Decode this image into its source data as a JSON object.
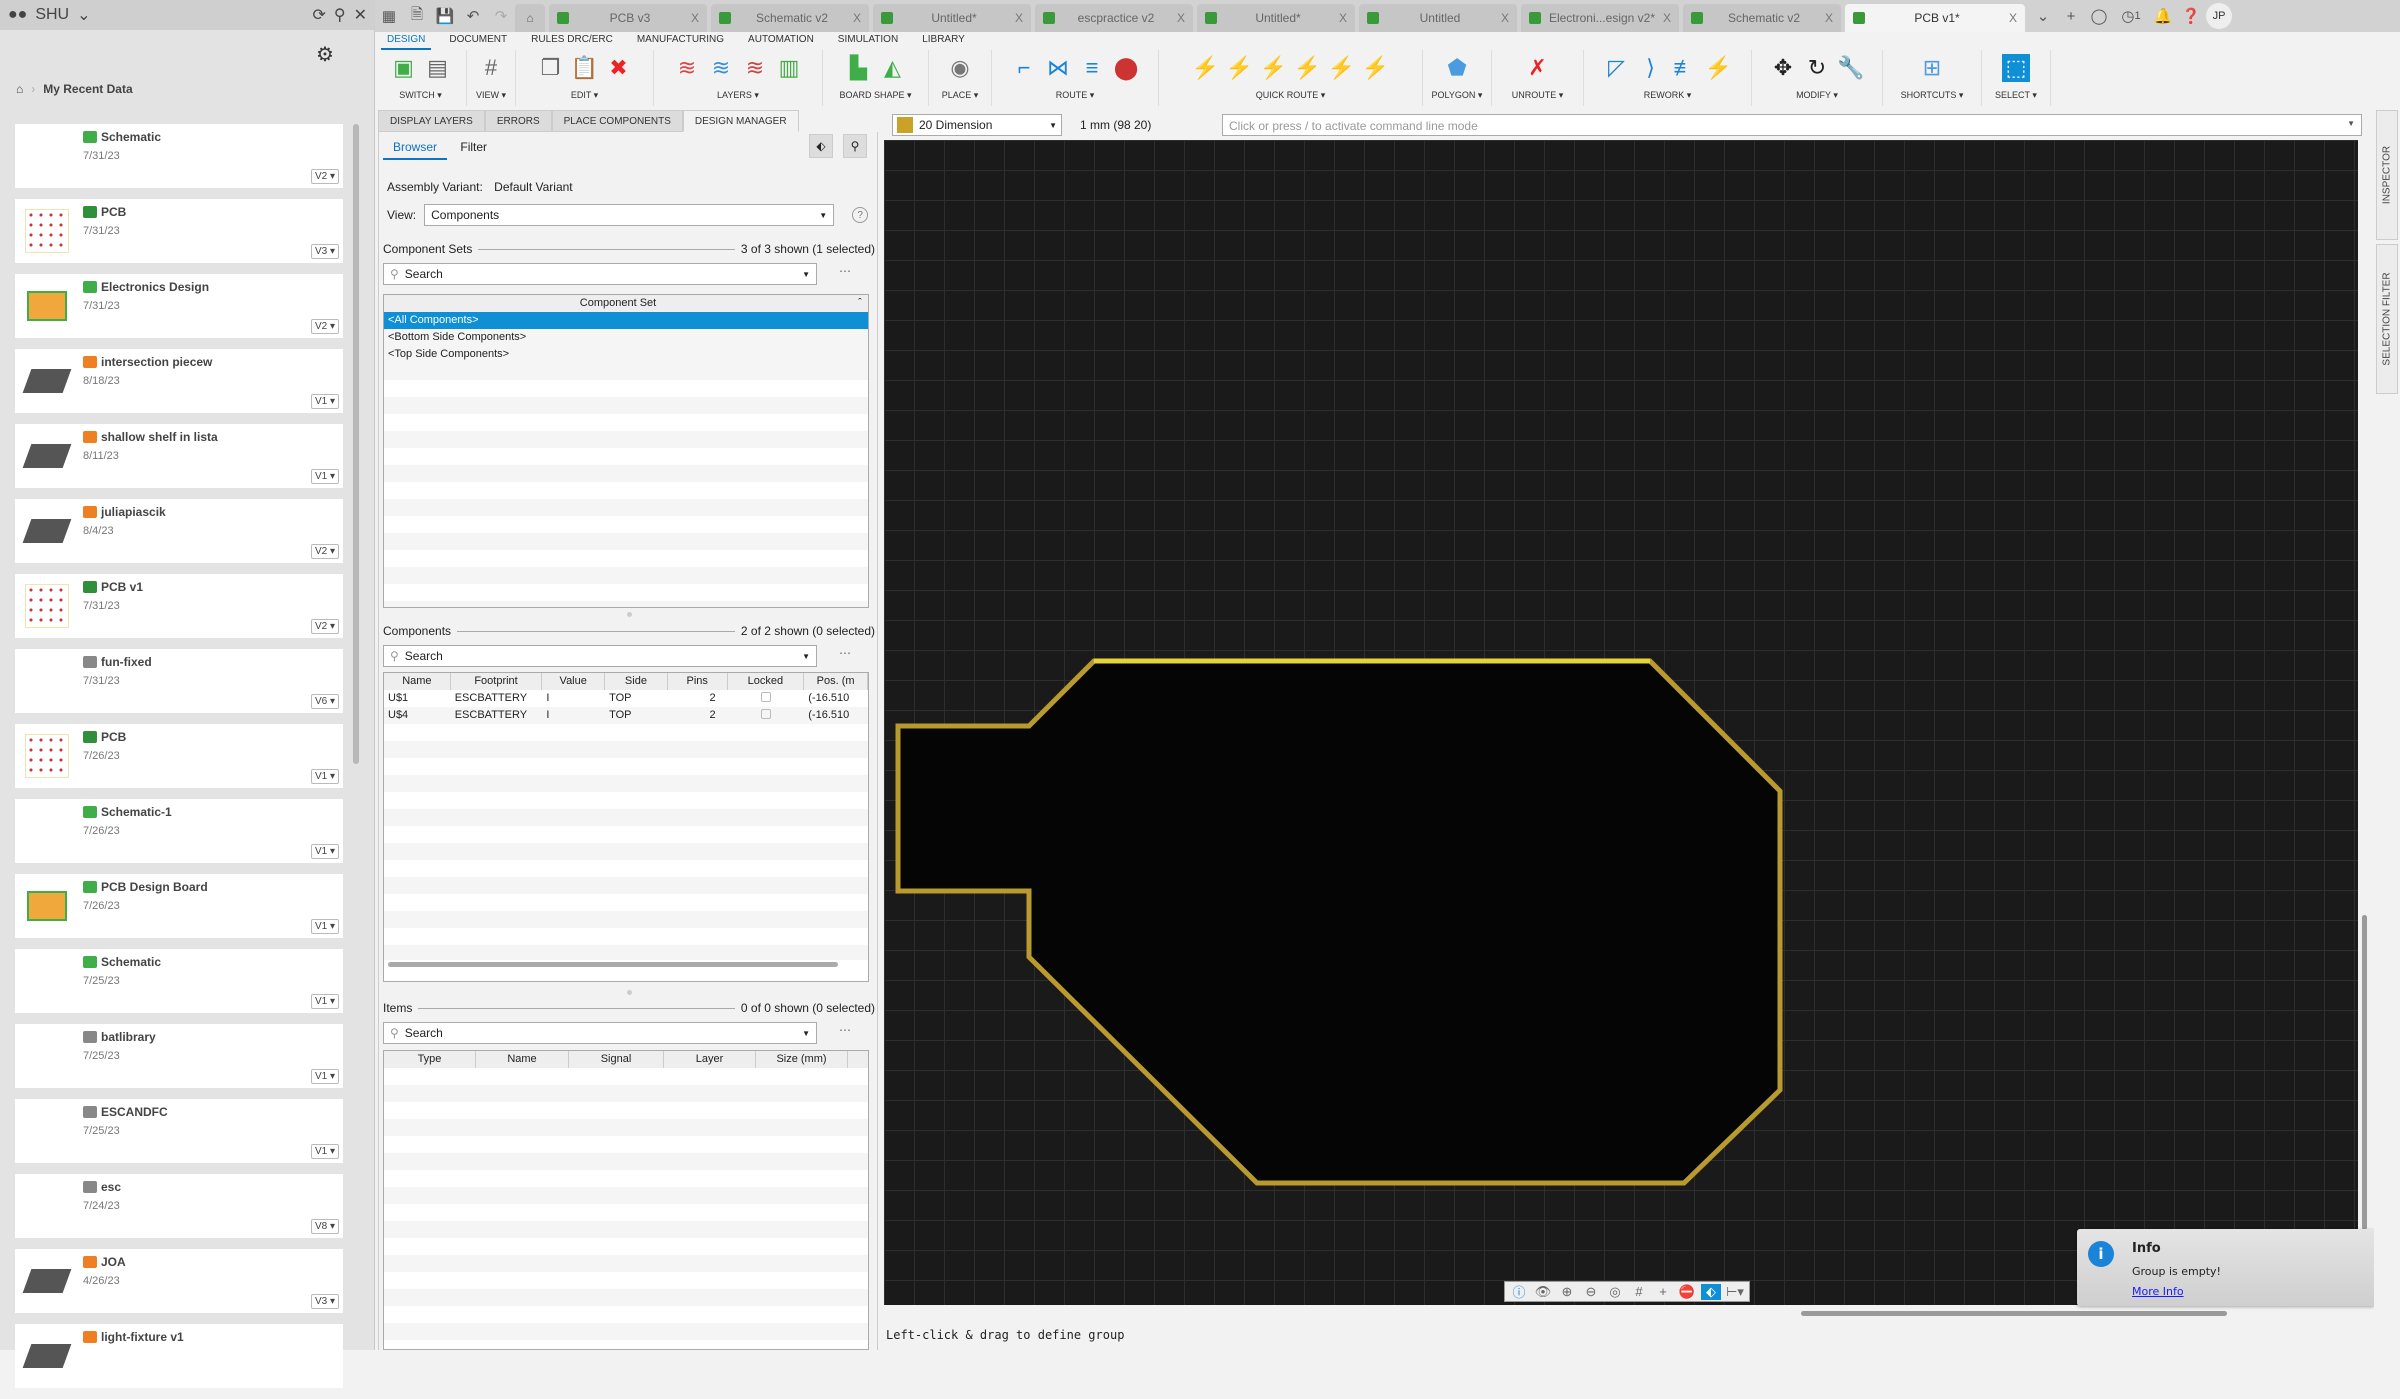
{
  "left_panel": {
    "team": "SHU",
    "breadcrumb": "My Recent Data",
    "files": [
      {
        "name": "Schematic",
        "date": "7/31/23",
        "version": "V2",
        "type": "schematic"
      },
      {
        "name": "PCB",
        "date": "7/31/23",
        "version": "V3",
        "type": "pcb"
      },
      {
        "name": "Electronics Design",
        "date": "7/31/23",
        "version": "V2",
        "type": "electronics"
      },
      {
        "name": "intersection piecew",
        "date": "8/18/23",
        "version": "V1",
        "type": "3d"
      },
      {
        "name": "shallow shelf in lista",
        "date": "8/11/23",
        "version": "V1",
        "type": "3d"
      },
      {
        "name": "juliapiascik",
        "date": "8/4/23",
        "version": "V2",
        "type": "3d"
      },
      {
        "name": "PCB v1",
        "date": "7/31/23",
        "version": "V2",
        "type": "pcb"
      },
      {
        "name": "fun-fixed",
        "date": "7/31/23",
        "version": "V6",
        "type": "library"
      },
      {
        "name": "PCB",
        "date": "7/26/23",
        "version": "V1",
        "type": "pcb"
      },
      {
        "name": "Schematic-1",
        "date": "7/26/23",
        "version": "V1",
        "type": "schematic"
      },
      {
        "name": "PCB Design Board",
        "date": "7/26/23",
        "version": "V1",
        "type": "electronics"
      },
      {
        "name": "Schematic",
        "date": "7/25/23",
        "version": "V1",
        "type": "schematic"
      },
      {
        "name": "batlibrary",
        "date": "7/25/23",
        "version": "V1",
        "type": "library"
      },
      {
        "name": "ESCANDFC",
        "date": "7/25/23",
        "version": "V1",
        "type": "library"
      },
      {
        "name": "esc",
        "date": "7/24/23",
        "version": "V8",
        "type": "library"
      },
      {
        "name": "JOA",
        "date": "4/26/23",
        "version": "V3",
        "type": "3d"
      },
      {
        "name": "light-fixture v1",
        "date": "",
        "version": "",
        "type": "3d"
      }
    ]
  },
  "doc_tabs": [
    {
      "label": "PCB v3",
      "active": false
    },
    {
      "label": "Schematic v2",
      "active": false
    },
    {
      "label": "Untitled*",
      "active": false
    },
    {
      "label": "escpractice v2",
      "active": false
    },
    {
      "label": "Untitled*",
      "active": false
    },
    {
      "label": "Untitled",
      "active": false
    },
    {
      "label": "Electroni...esign v2*",
      "active": false
    },
    {
      "label": "Schematic v2",
      "active": false
    },
    {
      "label": "PCB v1*",
      "active": true
    }
  ],
  "user": {
    "initials": "JP",
    "jobs_count": "1"
  },
  "ribbon_tabs": [
    "DESIGN",
    "DOCUMENT",
    "RULES DRC/ERC",
    "MANUFACTURING",
    "AUTOMATION",
    "SIMULATION",
    "LIBRARY"
  ],
  "ribbon_groups": [
    {
      "label": "SWITCH",
      "icons": [
        "schematic-switch",
        "board-3d"
      ]
    },
    {
      "label": "VIEW",
      "icons": [
        "grid"
      ]
    },
    {
      "label": "EDIT",
      "icons": [
        "copy",
        "paste",
        "delete"
      ]
    },
    {
      "label": "LAYERS",
      "icons": [
        "layers-a",
        "layers-b",
        "layers-c",
        "layer-settings"
      ]
    },
    {
      "label": "BOARD SHAPE",
      "icons": [
        "board-outline",
        "board-shape"
      ]
    },
    {
      "label": "PLACE",
      "icons": [
        "via"
      ]
    },
    {
      "label": "ROUTE",
      "icons": [
        "route",
        "differential-pair",
        "multi-route",
        "via-stack"
      ]
    },
    {
      "label": "QUICK ROUTE",
      "icons": [
        "qr-1",
        "qr-2",
        "qr-3",
        "qr-4",
        "qr-5",
        "qr-6"
      ]
    },
    {
      "label": "POLYGON",
      "icons": [
        "polygon"
      ]
    },
    {
      "label": "UNROUTE",
      "icons": [
        "unroute"
      ]
    },
    {
      "label": "REWORK",
      "icons": [
        "miter",
        "slide",
        "spread",
        "reroute"
      ]
    },
    {
      "label": "MODIFY",
      "icons": [
        "move",
        "rotate",
        "wrench"
      ]
    },
    {
      "label": "SHORTCUTS",
      "icons": [
        "shortcuts"
      ]
    },
    {
      "label": "SELECT",
      "icons": [
        "select"
      ]
    }
  ],
  "panel_tabs": [
    "DISPLAY LAYERS",
    "ERRORS",
    "PLACE COMPONENTS",
    "DESIGN MANAGER"
  ],
  "design_manager": {
    "subtabs": [
      "Browser",
      "Filter"
    ],
    "assembly_label": "Assembly Variant:",
    "assembly_value": "Default Variant",
    "view_label": "View:",
    "view_value": "Components",
    "component_sets": {
      "title": "Component Sets",
      "count": "3 of 3 shown (1 selected)",
      "search": "Search",
      "column": "Component Set",
      "rows": [
        "<All Components>",
        "<Bottom Side Components>",
        "<Top Side Components>"
      ]
    },
    "components": {
      "title": "Components",
      "count": "2 of 2 shown (0 selected)",
      "search": "Search",
      "columns": [
        "Name",
        "Footprint",
        "Value",
        "Side",
        "Pins",
        "Locked",
        "Pos. (m"
      ],
      "rows": [
        [
          "U$1",
          "ESCBATTERY",
          "I",
          "TOP",
          "2",
          "",
          "(-16.510"
        ],
        [
          "U$4",
          "ESCBATTERY",
          "I",
          "TOP",
          "2",
          "",
          "(-16.510"
        ]
      ]
    },
    "items": {
      "title": "Items",
      "count": "0 of 0 shown (0 selected)",
      "search": "Search",
      "columns": [
        "Type",
        "Name",
        "Signal",
        "Layer",
        "Size (mm)"
      ]
    }
  },
  "command_bar": {
    "layer": "20 Dimension",
    "layer_color": "#c9a227",
    "grid": "1 mm (98 20)",
    "placeholder": "Click or press / to activate command line mode"
  },
  "status": "Left-click & drag to define group",
  "toast": {
    "title": "Info",
    "message": "Group is empty!",
    "link": "More Info"
  },
  "side_panels": [
    "INSPECTOR",
    "SELECTION FILTER"
  ]
}
